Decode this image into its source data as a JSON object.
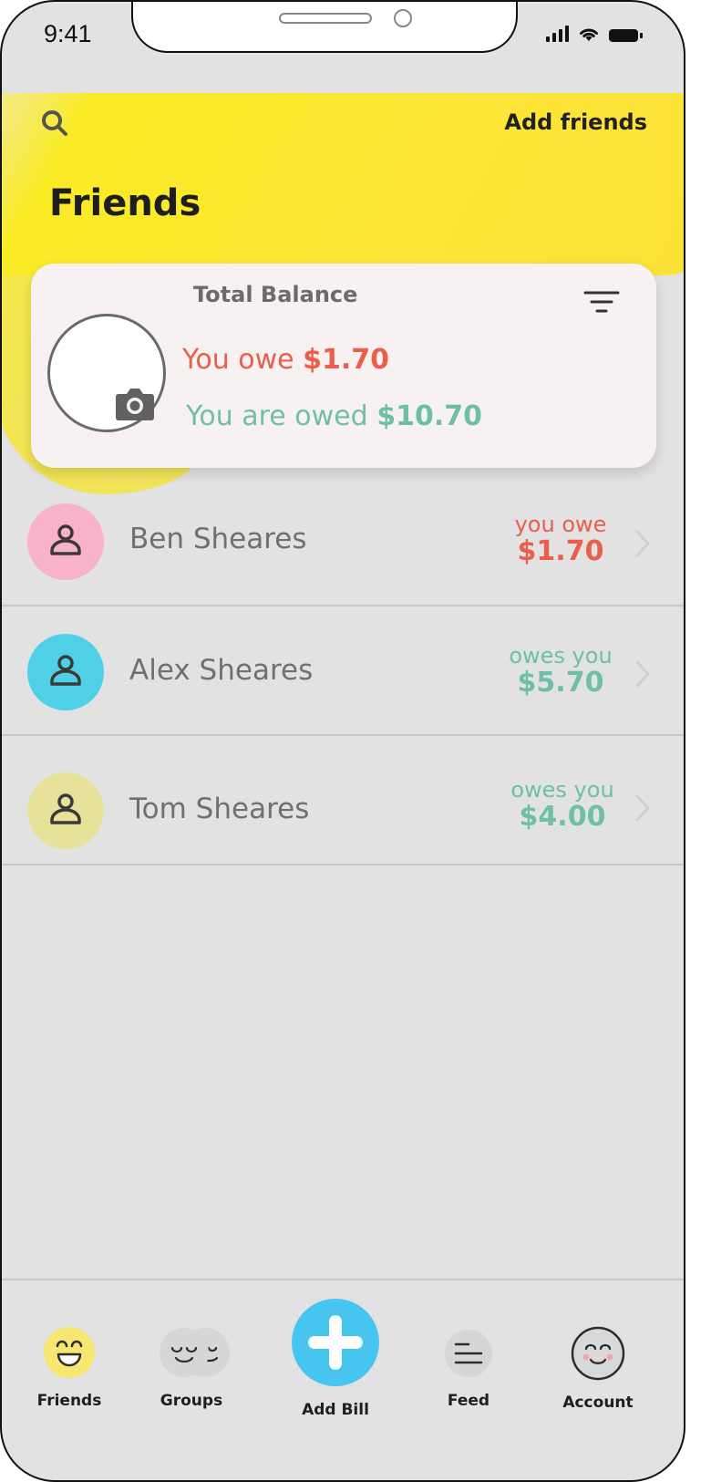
{
  "status_bar": {
    "time": "9:41"
  },
  "header": {
    "add_friends_label": "Add friends",
    "title": "Friends"
  },
  "balance_card": {
    "title": "Total Balance",
    "owe_prefix": "You owe ",
    "owe_amount": "$1.70",
    "owed_prefix": "You are owed ",
    "owed_amount": "$10.70"
  },
  "friends": [
    {
      "name": "Ben Sheares",
      "status": "you owe",
      "amount": "$1.70",
      "avatar_color": "#f9b2cb",
      "status_color": "#ea5e4b"
    },
    {
      "name": "Alex Sheares",
      "status": "owes you",
      "amount": "$5.70",
      "avatar_color": "#4fd0e6",
      "status_color": "#6fbfa8"
    },
    {
      "name": "Tom Sheares",
      "status": "owes you",
      "amount": "$4.00",
      "avatar_color": "#e6e29a",
      "status_color": "#6fbfa8"
    }
  ],
  "tabbar": {
    "friends": "Friends",
    "groups": "Groups",
    "add_bill": "Add Bill",
    "feed": "Feed",
    "account": "Account"
  },
  "colors": {
    "accent_yellow": "#fde637",
    "owe_red": "#ea5e4b",
    "owed_green": "#6fbfa8",
    "add_blue": "#46c6ee"
  }
}
